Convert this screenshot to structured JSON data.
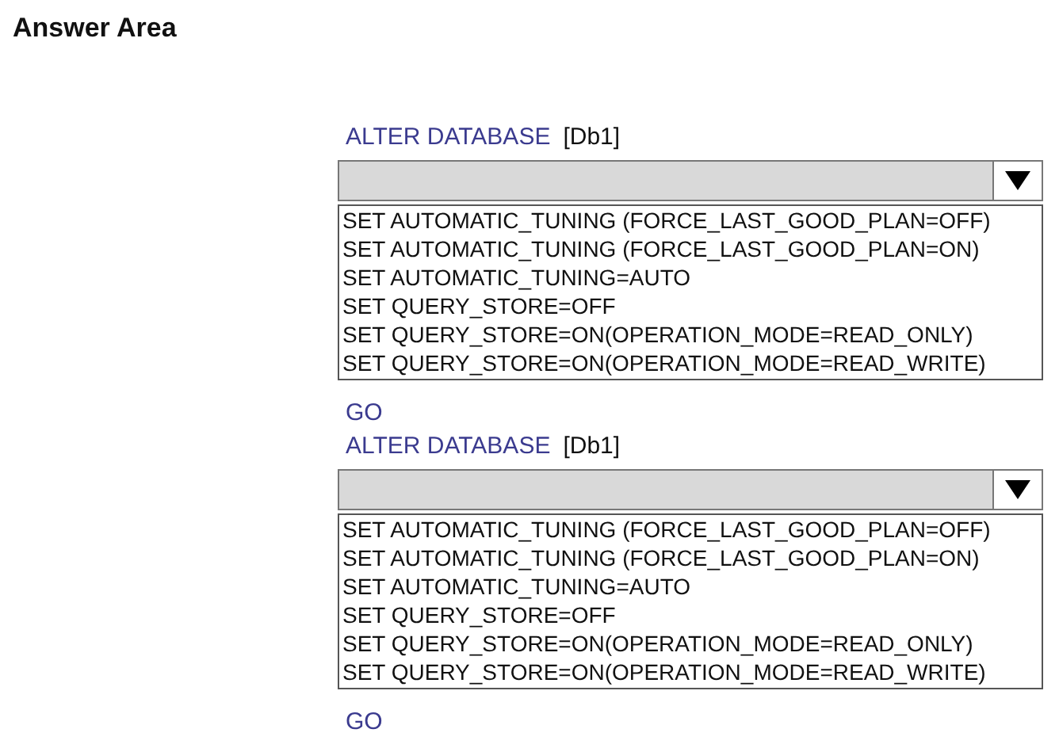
{
  "title": "Answer Area",
  "blocks": [
    {
      "keyword": "ALTER DATABASE",
      "target": "[Db1]",
      "options": [
        "SET AUTOMATIC_TUNING (FORCE_LAST_GOOD_PLAN=OFF)",
        "SET AUTOMATIC_TUNING (FORCE_LAST_GOOD_PLAN=ON)",
        "SET AUTOMATIC_TUNING=AUTO",
        "SET QUERY_STORE=OFF",
        "SET QUERY_STORE=ON(OPERATION_MODE=READ_ONLY)",
        "SET QUERY_STORE=ON(OPERATION_MODE=READ_WRITE)"
      ],
      "go": "GO"
    },
    {
      "keyword": "ALTER DATABASE",
      "target": "[Db1]",
      "options": [
        "SET AUTOMATIC_TUNING (FORCE_LAST_GOOD_PLAN=OFF)",
        "SET AUTOMATIC_TUNING (FORCE_LAST_GOOD_PLAN=ON)",
        "SET AUTOMATIC_TUNING=AUTO",
        "SET QUERY_STORE=OFF",
        "SET QUERY_STORE=ON(OPERATION_MODE=READ_ONLY)",
        "SET QUERY_STORE=ON(OPERATION_MODE=READ_WRITE)"
      ],
      "go": "GO"
    }
  ]
}
